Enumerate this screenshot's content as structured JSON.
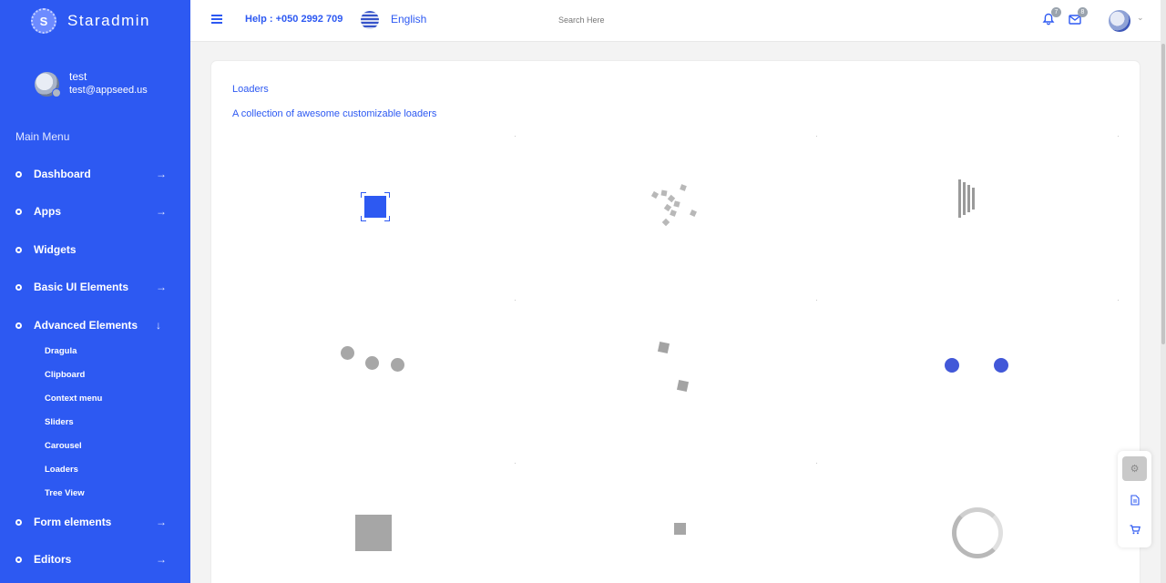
{
  "brand": {
    "logo_letter": "S",
    "name": "Staradmin"
  },
  "profile": {
    "name": "test",
    "email": "test@appseed.us"
  },
  "sidebar": {
    "heading": "Main Menu",
    "items": [
      {
        "label": "Dashboard",
        "arrow": "→",
        "icon": "arrow-right-icon"
      },
      {
        "label": "Apps",
        "arrow": "→",
        "icon": "arrow-right-icon"
      },
      {
        "label": "Widgets"
      },
      {
        "label": "Basic UI Elements",
        "arrow": "→",
        "icon": "arrow-right-icon"
      },
      {
        "label": "Advanced Elements",
        "arrow": "↓",
        "icon": "arrow-down-icon"
      },
      {
        "label": "Form elements",
        "arrow": "→",
        "icon": "arrow-right-icon"
      },
      {
        "label": "Editors",
        "arrow": "→",
        "icon": "arrow-right-icon"
      }
    ],
    "subitems": [
      "Dragula",
      "Clipboard",
      "Context menu",
      "Sliders",
      "Carousel",
      "Loaders",
      "Tree View"
    ]
  },
  "topbar": {
    "help": "Help : +050 2992 709",
    "language": "English",
    "search_placeholder": "Search Here",
    "notifications_count": "7",
    "messages_count": "8",
    "icons": [
      "menu-icon",
      "flag-icon",
      "bell-icon",
      "mail-icon",
      "avatar",
      "chevron-down-icon"
    ]
  },
  "main": {
    "title": "Loaders",
    "description": "A collection of awesome customizable loaders"
  },
  "float_panel": {
    "icons": [
      "gear-icon",
      "document-icon",
      "cart-icon"
    ]
  },
  "colors": {
    "primary": "#2d59f2",
    "loader_gray": "#a6a6a6",
    "loader_blue": "#4258d8"
  }
}
